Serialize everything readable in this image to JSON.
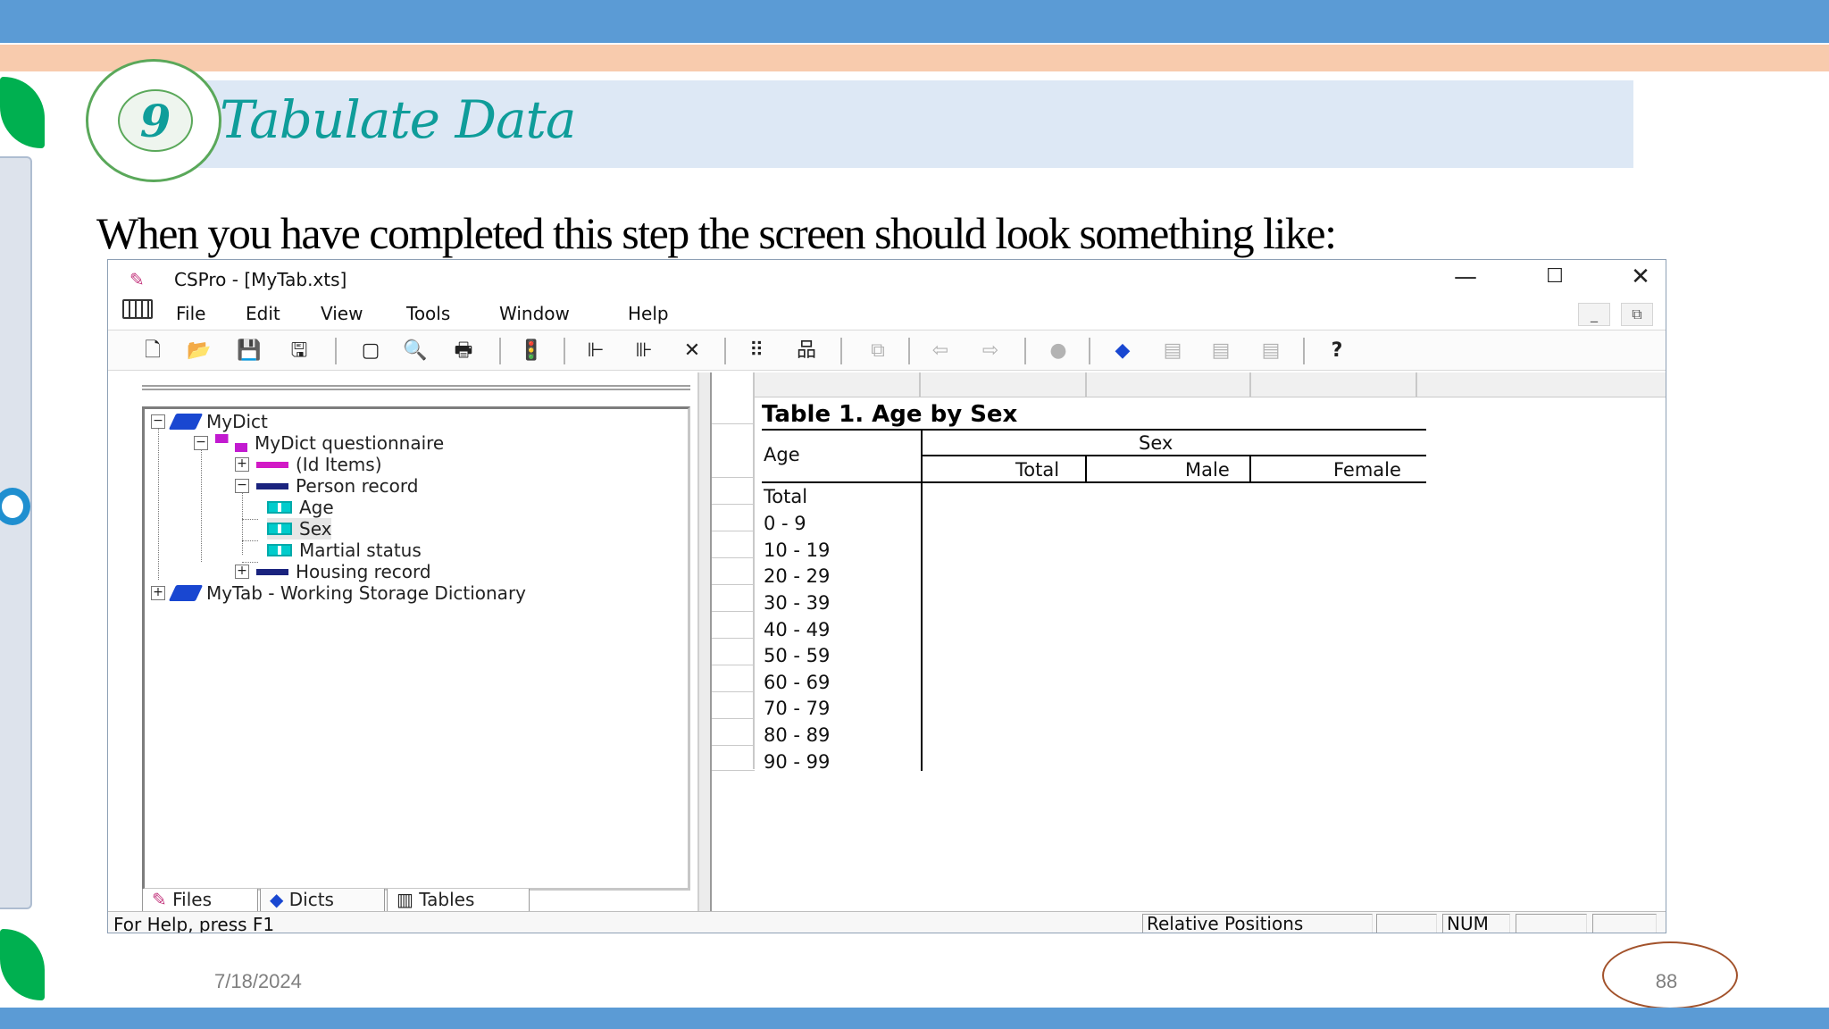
{
  "slide": {
    "step_number": "9",
    "title": "Tabulate Data",
    "subtitle": "When you have completed this step the screen should look something like:",
    "date": "7/18/2024",
    "page_number": "88"
  },
  "window": {
    "title": "CSPro - [MyTab.xts]",
    "controls": {
      "minimize": "—",
      "maximize": "☐",
      "close": "✕"
    },
    "menu": [
      "File",
      "Edit",
      "View",
      "Tools",
      "Window",
      "Help"
    ],
    "mdi_controls": {
      "minimize": "_",
      "restore": "⧉"
    },
    "status_text": "For Help, press F1",
    "status_panes": [
      "Relative Positions",
      "",
      "NUM",
      "",
      ""
    ]
  },
  "tree": [
    {
      "label": "MyDict",
      "icon": "book-icon"
    },
    {
      "label": "MyDict questionnaire",
      "icon": "questionnaire-icon"
    },
    {
      "label": "(Id Items)",
      "icon": "id-record-icon"
    },
    {
      "label": "Person record",
      "icon": "record-icon"
    },
    {
      "label": "Age",
      "icon": "item-icon"
    },
    {
      "label": "Sex",
      "icon": "item-icon"
    },
    {
      "label": "Martial status",
      "icon": "item-icon"
    },
    {
      "label": "Housing record",
      "icon": "record-icon"
    },
    {
      "label": "MyTab - Working Storage Dictionary",
      "icon": "book-icon"
    }
  ],
  "pane_tabs": [
    "Files",
    "Dicts",
    "Tables"
  ],
  "table": {
    "title": "Table 1. Age by Sex",
    "row_var": "Age",
    "col_var": "Sex",
    "columns": [
      "Total",
      "Male",
      "Female"
    ],
    "rows": [
      "Total",
      "0 - 9",
      "10 - 19",
      "20 - 29",
      "30 - 39",
      "40 - 49",
      "50 - 59",
      "60 - 69",
      "70 - 79",
      "80 - 89",
      "90 - 99"
    ]
  }
}
